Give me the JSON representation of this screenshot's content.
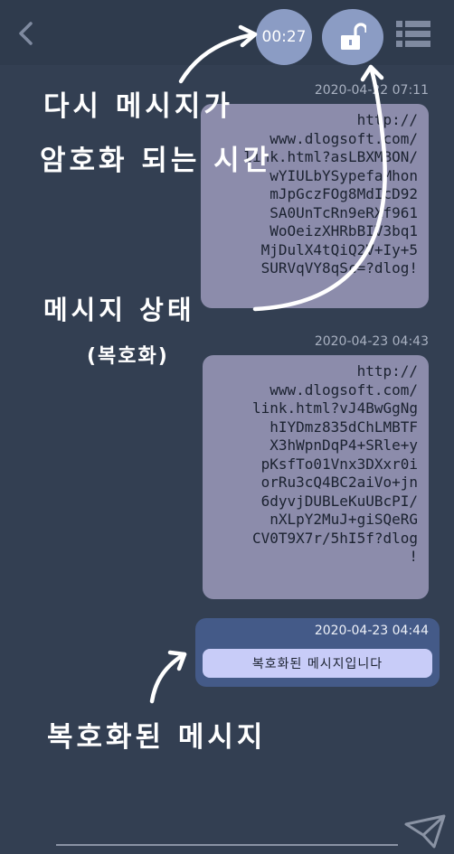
{
  "header": {
    "timer": "00:27",
    "icons": {
      "back": "chevron-left-icon",
      "lock": "unlocked-padlock-icon",
      "menu": "list-menu-icon"
    }
  },
  "messages": [
    {
      "timestamp": "2020-04-22 07:11",
      "lines": [
        "http://",
        "www.dlogsoft.com/",
        "link.html?asLBXMBON/",
        "wYIULbYSypefaMhon",
        "mJpGczFOg8MdIcD92",
        "SA0UnTcRn9eRXf961",
        "WoOeizXHRbBIV3bq1",
        "MjDulX4tQiQ2V+Iy+5",
        "SURVqVY8qSc=?dlog!"
      ]
    },
    {
      "timestamp": "2020-04-23 04:43",
      "lines": [
        "http://",
        "www.dlogsoft.com/",
        "link.html?vJ4BwGgNg",
        "hIYDmz835dChLMBTF",
        "X3hWpnDqP4+SRle+y",
        "pKsfTo01Vnx3DXxr0i",
        "orRu3cQ4BC2aiVo+jn",
        "6dyvjDUBLeKuUBcPI/",
        "nXLpY2MuJ+giSQeRG",
        "CV0T9X7r/5hI5f?dlog",
        "!"
      ]
    }
  ],
  "decrypted_message": {
    "timestamp": "2020-04-23 04:44",
    "text": "복호화된 메시지입니다"
  },
  "annotations": {
    "reencrypt_time_line1": "다시 메시지가",
    "reencrypt_time_line2": "암호화 되는 시간",
    "message_state": "메시지 상태",
    "message_state_sub": "(복호화)",
    "decrypted_message": "복호화된 메시지"
  },
  "colors": {
    "background": "#333f52",
    "accent": "#8b9cc4",
    "bubble": "#8c8cab",
    "card": "#445a88",
    "pill": "#c8ccf8"
  },
  "composer": {
    "send_icon": "paper-plane-icon"
  }
}
